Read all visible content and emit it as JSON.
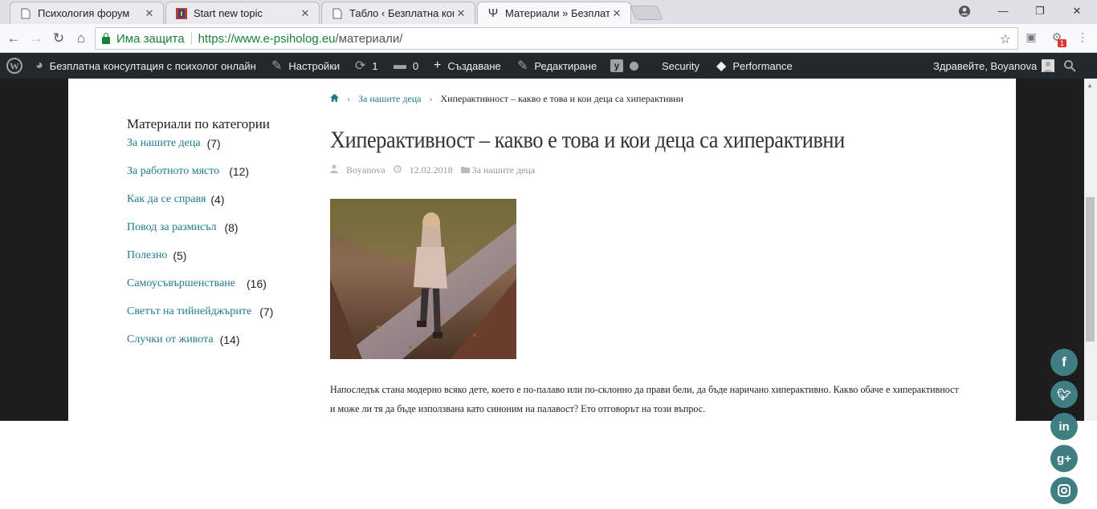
{
  "tabs": [
    {
      "title": "Психология форум",
      "favicon": "doc-icon"
    },
    {
      "title": "Start new topic",
      "favicon": "forum-icon"
    },
    {
      "title": "Табло ‹ Безплатна консу",
      "favicon": "doc-icon"
    },
    {
      "title": "Материали » Безплатна",
      "favicon": "psi-icon",
      "active": true
    }
  ],
  "address": {
    "secure_label": "Има защита",
    "url_host": "https://www.e-psiholog.eu",
    "url_path": "/материали/"
  },
  "adminbar": {
    "site": "Безплатна консултация с психолог онлайн",
    "settings": "Настройки",
    "updates": "1",
    "comments": "0",
    "new": "Създаване",
    "edit": "Редактиране",
    "security": "Security",
    "performance": "Performance",
    "greeting": "Здравейте, Boyanova"
  },
  "sidebar": {
    "heading": "Материали по категории",
    "items": [
      {
        "label": "За нашите деца",
        "count": "(7)"
      },
      {
        "label": "За работното място",
        "count": "(12)"
      },
      {
        "label": "Как да се справя",
        "count": "(4)"
      },
      {
        "label": "Повод за размисъл",
        "count": "(8)"
      },
      {
        "label": "Полезно",
        "count": "(5)"
      },
      {
        "label": "Самоусъвършенстване",
        "count": "(16)"
      },
      {
        "label": "Светът на тийнейджърите",
        "count": "(7)"
      },
      {
        "label": "Случки от живота",
        "count": "(14)"
      }
    ]
  },
  "breadcrumb": {
    "link": "За нашите деца",
    "current": "Хиперактивност – какво е това и кои деца са хиперактивни"
  },
  "post": {
    "title": "Хиперактивност – какво е това и кои деца са хиперактивни",
    "author": "Boyanova",
    "date": "12.02.2018",
    "category": "За нашите деца",
    "body": "Напоследък стана модерно всяко дете, което е по-палаво или по-склонно да прави бели, да бъде наричано хиперактивно. Какво обаче е хиперактивност и може ли тя да бъде използвана като синоним на палавост? Ето отговорът на този въпрос."
  },
  "social": [
    "f",
    "t",
    "in",
    "g+",
    "ig"
  ],
  "colors": {
    "accent": "#1f7a8c",
    "social": "#3f7f83",
    "adminbar": "#23282d"
  }
}
